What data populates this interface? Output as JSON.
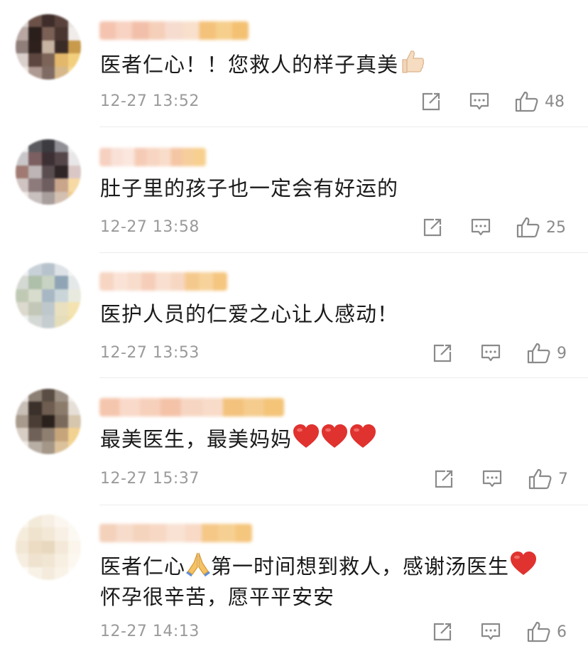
{
  "comments": [
    {
      "text_parts": [
        "医者仁心！！您救人的样子真美"
      ],
      "emoji": "thumbs-up",
      "time": "12-27 13:52",
      "likes": "48",
      "avatar_colors": [
        "#d9d2cf",
        "#6b5148",
        "#3e2d2a",
        "#5a423c",
        "#e8e3e1",
        "#b8a7a3",
        "#2b1f1c",
        "#7a6055",
        "#4a3631",
        "#f0ece9",
        "#8f7e7a",
        "#2e211d",
        "#c7b3a2",
        "#3a2b26",
        "#c89a4c",
        "#d9cfcb",
        "#5d4640",
        "#7c6558",
        "#e3b86c",
        "#f2cf7d",
        "#eee6e2",
        "#ae9a92",
        "#7f6b63",
        "#d6b88a",
        "#f5d88e"
      ],
      "name_colors": [
        "#f4c4b0",
        "#f8d2c2",
        "#f2c0aa",
        "#f5cfb9",
        "#f6dccf",
        "#f9e0cc",
        "#f4c27a",
        "#f6cf8c",
        "#f4c173"
      ]
    },
    {
      "text_parts": [
        "肚子里的孩子也一定会有好运的"
      ],
      "emoji": "",
      "time": "12-27 13:58",
      "likes": "25",
      "avatar_colors": [
        "#f0efef",
        "#5b5b5f",
        "#3b3b40",
        "#8f8f95",
        "#f2f1f1",
        "#c9c6c9",
        "#7c5f60",
        "#3c3034",
        "#55464a",
        "#e9e6e7",
        "#a07a72",
        "#bdb5b6",
        "#5a4d50",
        "#2f2628",
        "#d9c7c6",
        "#d0c4c2",
        "#8d7b7c",
        "#6e5e60",
        "#c9a58b",
        "#f6d9a3",
        "#efe8e6",
        "#c8bfbf",
        "#a89e9c",
        "#d4c0b1",
        "#f0cd8d"
      ],
      "name_colors": [
        "#f6d0c0",
        "#f9e1d8",
        "#fbe7de",
        "#f6cbb6",
        "#f7d5c2",
        "#f9dcc9",
        "#f5c6a4",
        "#f6ce9c",
        "#f7d08f"
      ]
    },
    {
      "text_parts": [
        "医护人员的仁爱之心让人感动！"
      ],
      "emoji": "",
      "time": "12-27 13:53",
      "likes": "9",
      "avatar_colors": [
        "#eef0f2",
        "#c8d0d8",
        "#b7c3cc",
        "#dde2e6",
        "#f3f4f5",
        "#d5d9d3",
        "#aebfaa",
        "#c9d3c3",
        "#8fa5b5",
        "#e4e8e8",
        "#bfc9b4",
        "#d8dccd",
        "#a7b7c3",
        "#cad5d9",
        "#e8eadf",
        "#dcd9ce",
        "#c3c7b7",
        "#bec8cc",
        "#e9e0c0",
        "#f4e3b1",
        "#f0f1f1",
        "#d5d9d5",
        "#c6cdd1",
        "#e6ddba",
        "#f5e0a2"
      ],
      "name_colors": [
        "#f7d5c3",
        "#fae3d6",
        "#f8dccc",
        "#f6cdb9",
        "#f9dfcf",
        "#f7d7c2",
        "#f5c98d",
        "#f7d39b",
        "#f5c67f"
      ]
    },
    {
      "text_parts": [
        "最美医生，最美妈妈"
      ],
      "emoji": "hearts-3",
      "time": "12-27 15:37",
      "likes": "7",
      "avatar_colors": [
        "#ebe8e5",
        "#8c7f73",
        "#5a4d43",
        "#9e9287",
        "#f1eee9",
        "#c8bfb6",
        "#3b302a",
        "#6e5d50",
        "#8b7b6b",
        "#e6dfd8",
        "#a89a8c",
        "#4a3d35",
        "#2a211c",
        "#7a6a5b",
        "#d7c6ae",
        "#d8cec4",
        "#6f6157",
        "#8e7f70",
        "#c6a57b",
        "#f2d291",
        "#ede8e2",
        "#b8aea4",
        "#a49788",
        "#dcc29a",
        "#f4d694"
      ],
      "name_colors": [
        "#f5c6ae",
        "#f9d9c9",
        "#f7d0bb",
        "#f4c2a7",
        "#f6d6c2",
        "#f8dbc8",
        "#f3c27c",
        "#f5cc8e",
        "#f4c478"
      ]
    },
    {
      "text_parts": [
        "医者仁心",
        "第一时间想到救人，感谢汤医生"
      ],
      "line2": "怀孕很辛苦，愿平平安安",
      "emoji": "praying-hands",
      "emoji2": "heart",
      "time": "12-27 14:13",
      "likes": "6",
      "avatar_colors": [
        "#fbf6ee",
        "#f4ead9",
        "#f7efe3",
        "#fbf7f0",
        "#fdfaf5",
        "#f5ecdc",
        "#efe3ce",
        "#f3e8d6",
        "#f8f0e4",
        "#fcf8f2",
        "#f2e7d4",
        "#ebdcc3",
        "#e8d8c0",
        "#f4e9d8",
        "#fbf5ec",
        "#f6eee1",
        "#efe3cf",
        "#f1e6d3",
        "#f7efe1",
        "#fcf7ef",
        "#fdfaf6",
        "#f8f1e6",
        "#f4ebdd",
        "#f9f2e7",
        "#fefbf7"
      ],
      "name_colors": [
        "#f4d1bb",
        "#f7dccb",
        "#f5d4be",
        "#f7d8c4",
        "#f9e2d3",
        "#f8dac6",
        "#f5c888",
        "#f6d093",
        "#f5c67e"
      ]
    }
  ]
}
